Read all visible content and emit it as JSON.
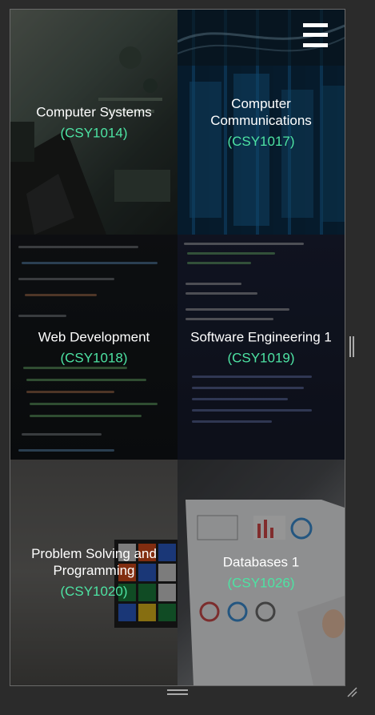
{
  "menu": {
    "icon": "hamburger-menu-icon"
  },
  "modules": [
    {
      "title": "Computer Systems",
      "code": "(CSY1014)"
    },
    {
      "title": "Computer Communications",
      "code": "(CSY1017)"
    },
    {
      "title": "Web Development",
      "code": "(CSY1018)"
    },
    {
      "title": "Software Engineering 1",
      "code": "(CSY1019)"
    },
    {
      "title": "Problem Solving and Programming",
      "code": "(CSY1020)"
    },
    {
      "title": "Databases 1",
      "code": "(CSY1026)"
    }
  ],
  "colors": {
    "accent": "#4de3a3",
    "title": "#ffffff",
    "background": "#2b2b2b"
  }
}
